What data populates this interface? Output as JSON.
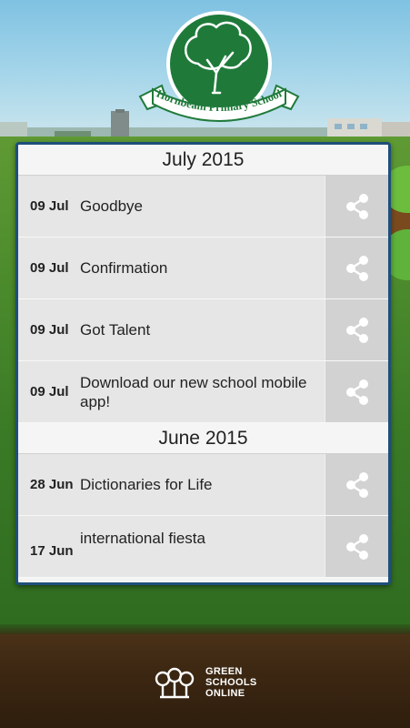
{
  "school": {
    "name": "Hornbeam Primary School",
    "logo_icon": "hornbeam-tree-icon"
  },
  "sections": [
    {
      "month": "July 2015",
      "items": [
        {
          "date": "09 Jul",
          "title": "Goodbye"
        },
        {
          "date": "09 Jul",
          "title": "Confirmation"
        },
        {
          "date": "09 Jul",
          "title": "Got Talent"
        },
        {
          "date": "09 Jul",
          "title": "Download our new school mobile app!"
        }
      ]
    },
    {
      "month": "June 2015",
      "items": [
        {
          "date": "28 Jun",
          "title": "Dictionaries for Life"
        },
        {
          "date": "17 Jun",
          "title": "international fiesta"
        }
      ]
    }
  ],
  "share_icon": "share-icon",
  "footer": {
    "brand_line1": "GREEN",
    "brand_line2": "SCHOOLS",
    "brand_line3": "ONLINE",
    "brand_icon": "green-schools-online-logo-icon"
  },
  "colors": {
    "logo_green": "#1f7a3a",
    "card_border": "#1e4f7a",
    "row_bg": "#e6e6e6",
    "share_bg": "#d2d2d2"
  }
}
